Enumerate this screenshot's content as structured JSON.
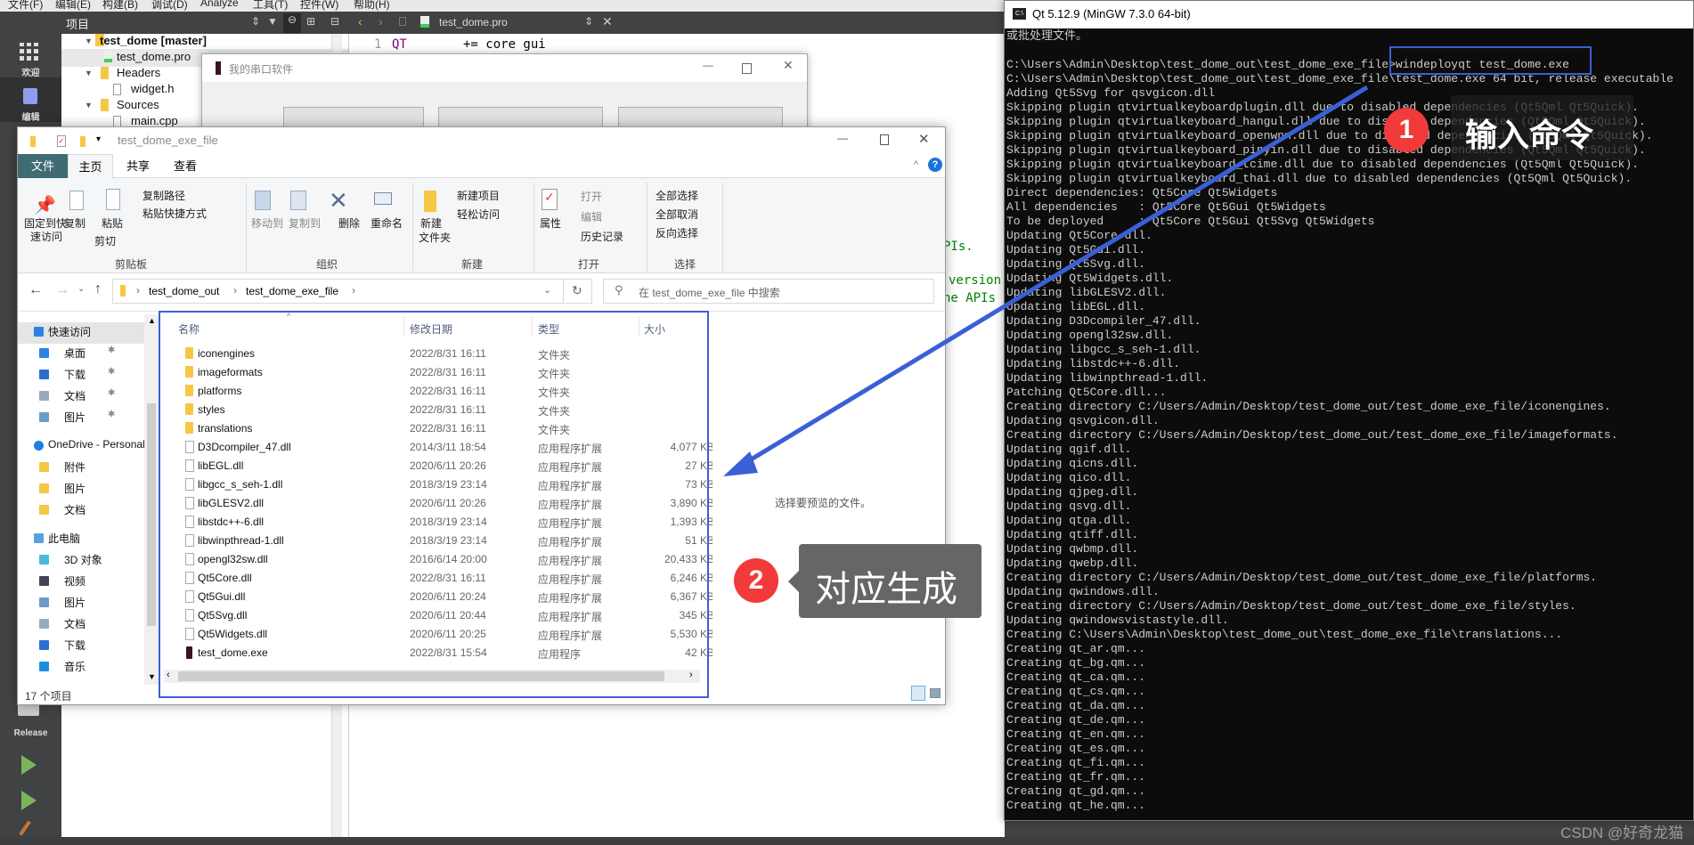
{
  "creator": {
    "menu": [
      "文件(F)",
      "编辑(E)",
      "构建(B)",
      "调试(D)",
      "Analyze",
      "工具(T)",
      "控件(W)",
      "帮助(H)"
    ],
    "project_panel_title": "项目",
    "editor_tab": "test_dome.pro",
    "modes": {
      "welcome": "欢迎",
      "edit": "编辑",
      "build_config": "Release"
    },
    "tree": [
      {
        "label": "test_dome [master]",
        "bold": true
      },
      {
        "label": "test_dome.pro"
      },
      {
        "label": "Headers"
      },
      {
        "label": "widget.h"
      },
      {
        "label": "Sources"
      },
      {
        "label": "main.cpp"
      }
    ],
    "code": {
      "line_number": "1",
      "keyword": "QT",
      "rest": "+= core gui",
      "frag1": "PIs.",
      "frag2": "version",
      "frag3": "he APIs"
    }
  },
  "serial_window": {
    "title": "我的串口软件"
  },
  "explorer": {
    "title": "test_dome_exe_file",
    "tabs": [
      "文件",
      "主页",
      "共享",
      "查看"
    ],
    "ribbon": {
      "pin": "固定到快",
      "pin2": "速访问",
      "copy": "复制",
      "paste": "粘贴",
      "copy_path": "复制路径",
      "paste_shortcut": "粘贴快捷方式",
      "cut": "剪切",
      "clipboard": "剪贴板",
      "move_to": "移动到",
      "copy_to": "复制到",
      "delete": "删除",
      "rename": "重命名",
      "organize": "组织",
      "new_folder": "新建",
      "new_folder2": "文件夹",
      "new_item": "新建项目",
      "easy_access": "轻松访问",
      "new": "新建",
      "properties": "属性",
      "open_btn": "打开",
      "edit": "编辑",
      "history": "历史记录",
      "open": "打开",
      "select_all": "全部选择",
      "select_none": "全部取消",
      "invert": "反向选择",
      "select": "选择"
    },
    "breadcrumb": [
      "test_dome_out",
      "test_dome_exe_file"
    ],
    "search_placeholder": "在 test_dome_exe_file 中搜索",
    "nav": [
      {
        "label": "快速访问",
        "level": 0,
        "icon": "star"
      },
      {
        "label": "桌面",
        "level": 1,
        "icon": "desktop",
        "pinned": true
      },
      {
        "label": "下载",
        "level": 1,
        "icon": "download",
        "pinned": true
      },
      {
        "label": "文档",
        "level": 1,
        "icon": "document",
        "pinned": true
      },
      {
        "label": "图片",
        "level": 1,
        "icon": "picture",
        "pinned": true
      },
      {
        "label": "OneDrive - Personal",
        "level": 0,
        "icon": "cloud"
      },
      {
        "label": "附件",
        "level": 1,
        "icon": "folder"
      },
      {
        "label": "图片",
        "level": 1,
        "icon": "folder"
      },
      {
        "label": "文档",
        "level": 1,
        "icon": "folder"
      },
      {
        "label": "此电脑",
        "level": 0,
        "icon": "computer"
      },
      {
        "label": "3D 对象",
        "level": 1,
        "icon": "cube"
      },
      {
        "label": "视频",
        "level": 1,
        "icon": "video"
      },
      {
        "label": "图片",
        "level": 1,
        "icon": "picture"
      },
      {
        "label": "文档",
        "level": 1,
        "icon": "document"
      },
      {
        "label": "下载",
        "level": 1,
        "icon": "download"
      },
      {
        "label": "音乐",
        "level": 1,
        "icon": "music"
      }
    ],
    "columns": [
      "名称",
      "修改日期",
      "类型",
      "大小"
    ],
    "files": [
      {
        "name": "iconengines",
        "date": "2022/8/31 16:11",
        "type": "文件夹",
        "size": "",
        "kind": "folder"
      },
      {
        "name": "imageformats",
        "date": "2022/8/31 16:11",
        "type": "文件夹",
        "size": "",
        "kind": "folder"
      },
      {
        "name": "platforms",
        "date": "2022/8/31 16:11",
        "type": "文件夹",
        "size": "",
        "kind": "folder"
      },
      {
        "name": "styles",
        "date": "2022/8/31 16:11",
        "type": "文件夹",
        "size": "",
        "kind": "folder"
      },
      {
        "name": "translations",
        "date": "2022/8/31 16:11",
        "type": "文件夹",
        "size": "",
        "kind": "folder"
      },
      {
        "name": "D3Dcompiler_47.dll",
        "date": "2014/3/11 18:54",
        "type": "应用程序扩展",
        "size": "4,077 KB",
        "kind": "dll"
      },
      {
        "name": "libEGL.dll",
        "date": "2020/6/11 20:26",
        "type": "应用程序扩展",
        "size": "27 KB",
        "kind": "dll"
      },
      {
        "name": "libgcc_s_seh-1.dll",
        "date": "2018/3/19 23:14",
        "type": "应用程序扩展",
        "size": "73 KB",
        "kind": "dll"
      },
      {
        "name": "libGLESV2.dll",
        "date": "2020/6/11 20:26",
        "type": "应用程序扩展",
        "size": "3,890 KB",
        "kind": "dll"
      },
      {
        "name": "libstdc++-6.dll",
        "date": "2018/3/19 23:14",
        "type": "应用程序扩展",
        "size": "1,393 KB",
        "kind": "dll"
      },
      {
        "name": "libwinpthread-1.dll",
        "date": "2018/3/19 23:14",
        "type": "应用程序扩展",
        "size": "51 KB",
        "kind": "dll"
      },
      {
        "name": "opengl32sw.dll",
        "date": "2016/6/14 20:00",
        "type": "应用程序扩展",
        "size": "20,433 KB",
        "kind": "dll"
      },
      {
        "name": "Qt5Core.dll",
        "date": "2022/8/31 16:11",
        "type": "应用程序扩展",
        "size": "6,246 KB",
        "kind": "dll"
      },
      {
        "name": "Qt5Gui.dll",
        "date": "2020/6/11 20:24",
        "type": "应用程序扩展",
        "size": "6,367 KB",
        "kind": "dll"
      },
      {
        "name": "Qt5Svg.dll",
        "date": "2020/6/11 20:44",
        "type": "应用程序扩展",
        "size": "345 KB",
        "kind": "dll"
      },
      {
        "name": "Qt5Widgets.dll",
        "date": "2020/6/11 20:25",
        "type": "应用程序扩展",
        "size": "5,530 KB",
        "kind": "dll"
      },
      {
        "name": "test_dome.exe",
        "date": "2022/8/31 15:54",
        "type": "应用程序",
        "size": "42 KB",
        "kind": "exe"
      }
    ],
    "status": "17 个项目",
    "preview_text": "选择要预览的文件。"
  },
  "terminal": {
    "title": "Qt 5.12.9 (MinGW 7.3.0 64-bit)",
    "lines": [
      "或批处理文件。",
      "",
      "C:\\Users\\Admin\\Desktop\\test_dome_out\\test_dome_exe_file>windeployqt test_dome.exe",
      "C:\\Users\\Admin\\Desktop\\test_dome_out\\test_dome_exe_file\\test_dome.exe 64 bit, release executable",
      "Adding Qt5Svg for qsvgicon.dll",
      "Skipping plugin qtvirtualkeyboardplugin.dll due to disabled dependencies (Qt5Qml Qt5Quick).",
      "Skipping plugin qtvirtualkeyboard_hangul.dll due to disabled dependencies (Qt5Qml Qt5Quick).",
      "Skipping plugin qtvirtualkeyboard_openwnn.dll due to disabled dependencies (Qt5Qml Qt5Quick).",
      "Skipping plugin qtvirtualkeyboard_pinyin.dll due to disabled dependencies (Qt5Qml Qt5Quick).",
      "Skipping plugin qtvirtualkeyboard_tcime.dll due to disabled dependencies (Qt5Qml Qt5Quick).",
      "Skipping plugin qtvirtualkeyboard_thai.dll due to disabled dependencies (Qt5Qml Qt5Quick).",
      "Direct dependencies: Qt5Core Qt5Widgets",
      "All dependencies   : Qt5Core Qt5Gui Qt5Widgets",
      "To be deployed     : Qt5Core Qt5Gui Qt5Svg Qt5Widgets",
      "Updating Qt5Core.dll.",
      "Updating Qt5Gui.dll.",
      "Updating Qt5Svg.dll.",
      "Updating Qt5Widgets.dll.",
      "Updating libGLESV2.dll.",
      "Updating libEGL.dll.",
      "Updating D3Dcompiler_47.dll.",
      "Updating opengl32sw.dll.",
      "Updating libgcc_s_seh-1.dll.",
      "Updating libstdc++-6.dll.",
      "Updating libwinpthread-1.dll.",
      "Patching Qt5Core.dll...",
      "Creating directory C:/Users/Admin/Desktop/test_dome_out/test_dome_exe_file/iconengines.",
      "Updating qsvgicon.dll.",
      "Creating directory C:/Users/Admin/Desktop/test_dome_out/test_dome_exe_file/imageformats.",
      "Updating qgif.dll.",
      "Updating qicns.dll.",
      "Updating qico.dll.",
      "Updating qjpeg.dll.",
      "Updating qsvg.dll.",
      "Updating qtga.dll.",
      "Updating qtiff.dll.",
      "Updating qwbmp.dll.",
      "Updating qwebp.dll.",
      "Creating directory C:/Users/Admin/Desktop/test_dome_out/test_dome_exe_file/platforms.",
      "Updating qwindows.dll.",
      "Creating directory C:/Users/Admin/Desktop/test_dome_out/test_dome_exe_file/styles.",
      "Updating qwindowsvistastyle.dll.",
      "Creating C:\\Users\\Admin\\Desktop\\test_dome_out\\test_dome_exe_file\\translations...",
      "Creating qt_ar.qm...",
      "Creating qt_bg.qm...",
      "Creating qt_ca.qm...",
      "Creating qt_cs.qm...",
      "Creating qt_da.qm...",
      "Creating qt_de.qm...",
      "Creating qt_en.qm...",
      "Creating qt_es.qm...",
      "Creating qt_fi.qm...",
      "Creating qt_fr.qm...",
      "Creating qt_gd.qm...",
      "Creating qt_he.qm..."
    ]
  },
  "annotations": {
    "step1_number": "1",
    "step1_label": "输入命令",
    "step2_number": "2",
    "step2_label": "对应生成",
    "highlight_color": "#3a5fd6",
    "badge_color": "#f23a3a"
  },
  "watermark": "CSDN @好奇龙猫"
}
